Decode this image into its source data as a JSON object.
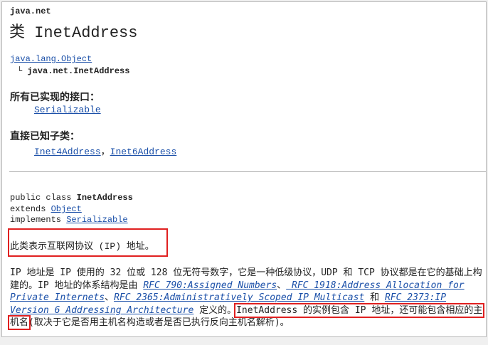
{
  "package": "java.net",
  "title": "类 InetAddress",
  "inheritance": {
    "parent": "java.lang.Object",
    "child": "└ java.net.InetAddress"
  },
  "interfaces": {
    "heading": "所有已实现的接口：",
    "items": [
      "Serializable"
    ]
  },
  "subclasses": {
    "heading": "直接已知子类：",
    "items": [
      "Inet4Address",
      "Inet6Address"
    ],
    "sep": "，"
  },
  "declaration": {
    "line1_prefix": "public class ",
    "line1_name": "InetAddress",
    "extends_kw": "extends ",
    "extends": "Object",
    "implements_kw": "implements ",
    "implements": "Serializable"
  },
  "summary": "此类表示互联网协议 (IP) 地址。",
  "body": {
    "t1": "IP 地址是 IP 使用的 32 位或 128 位无符号数字，它是一种低级协议，UDP 和 TCP 协议都是在它的基础上构建的。IP 地址的体系结构是由 ",
    "l1": "RFC 790:Assigned Numbers",
    "s1": "、",
    "l2": " RFC 1918:Address Allocation for Private Internets",
    "s2": "、",
    "l3": "RFC 2365:Administratively Scoped IP Multicast",
    "t2": " 和 ",
    "l4": "RFC 2373:IP Version 6 Addressing Architecture",
    "t3": " 定义的。",
    "highlight": "InetAddress 的实例包含 IP 地址，还可能包含相应的主机名",
    "t4": "(取决于它是否用主机名构造或者是否已执行反向主机名解析)。"
  }
}
